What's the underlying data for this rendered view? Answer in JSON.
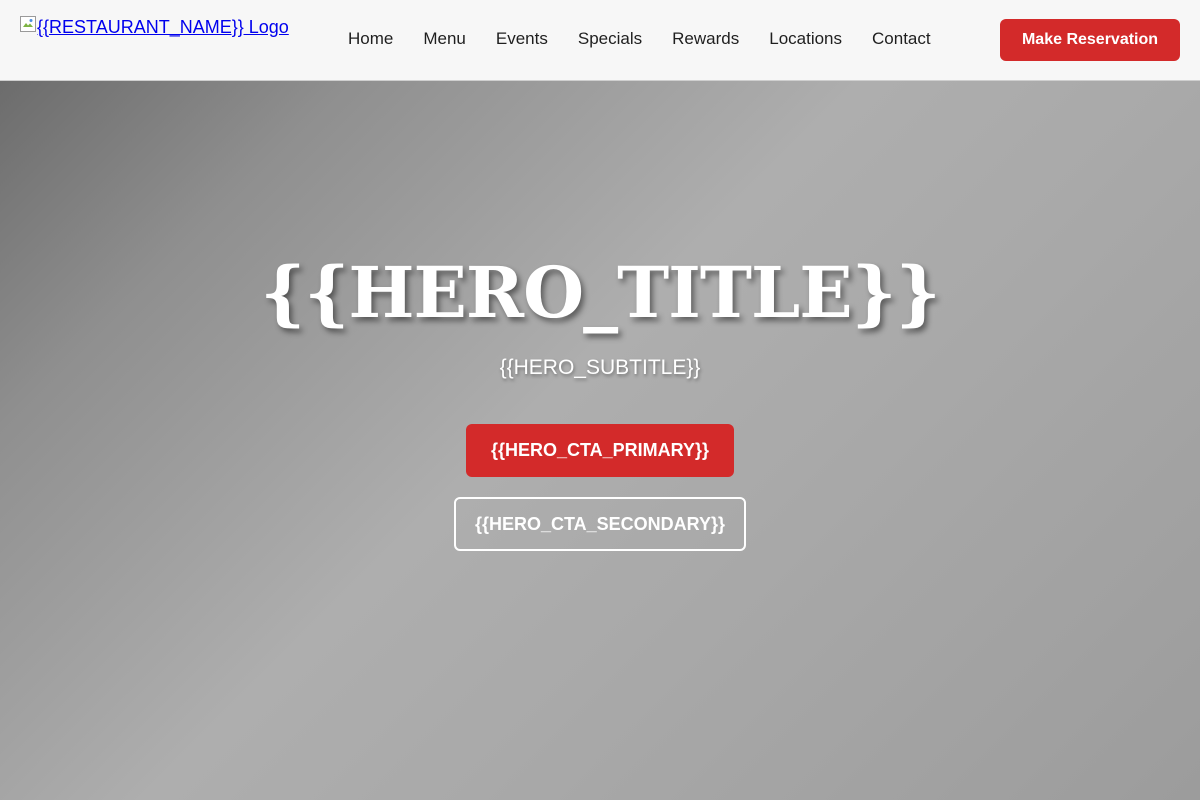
{
  "header": {
    "logo_alt": "{{RESTAURANT_NAME}} Logo",
    "nav": [
      {
        "label": "Home"
      },
      {
        "label": "Menu"
      },
      {
        "label": "Events"
      },
      {
        "label": "Specials"
      },
      {
        "label": "Rewards"
      },
      {
        "label": "Locations"
      },
      {
        "label": "Contact"
      }
    ],
    "reserve_label": "Make Reservation"
  },
  "hero": {
    "title": "{{HERO_TITLE}}",
    "subtitle": "{{HERO_SUBTITLE}}",
    "cta_primary": "{{HERO_CTA_PRIMARY}}",
    "cta_secondary": "{{HERO_CTA_SECONDARY}}"
  },
  "colors": {
    "accent": "#d32a2a",
    "header_bg": "#f7f7f7",
    "link": "#0000ee"
  },
  "icons": {
    "logo": "broken-image-icon"
  }
}
